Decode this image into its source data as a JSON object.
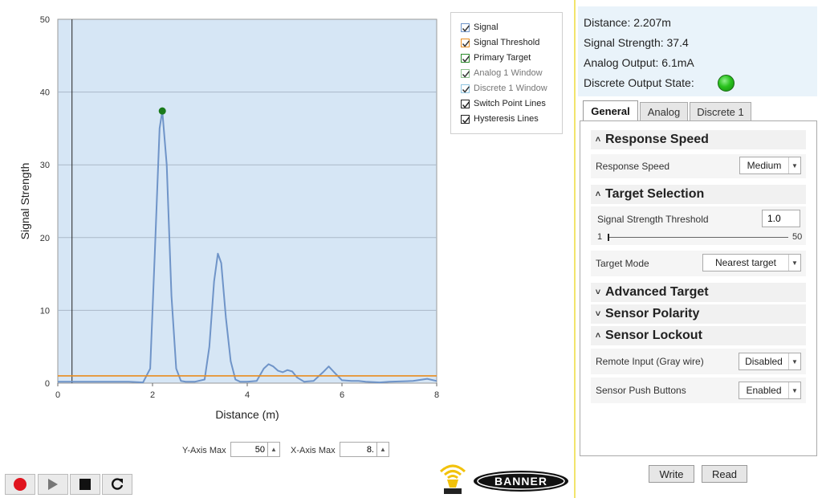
{
  "chart_data": {
    "type": "line",
    "xlabel": "Distance (m)",
    "ylabel": "Signal Strength",
    "xlim": [
      0,
      8
    ],
    "ylim": [
      0,
      50
    ],
    "x_ticks": [
      "0",
      "2",
      "4",
      "6",
      "8"
    ],
    "y_ticks": [
      "0",
      "10",
      "20",
      "30",
      "40",
      "50"
    ],
    "grid": true,
    "legend_placement": "top-right",
    "series": [
      {
        "name": "Signal",
        "color": "#6f94c8",
        "x": [
          0,
          0.5,
          1.0,
          1.5,
          1.8,
          1.95,
          2.05,
          2.15,
          2.207,
          2.3,
          2.4,
          2.5,
          2.6,
          2.7,
          2.9,
          3.1,
          3.2,
          3.3,
          3.38,
          3.45,
          3.55,
          3.65,
          3.75,
          3.85,
          4.0,
          4.2,
          4.35,
          4.45,
          4.55,
          4.65,
          4.75,
          4.85,
          4.95,
          5.05,
          5.2,
          5.4,
          5.6,
          5.72,
          5.85,
          6.0,
          6.2,
          6.35,
          6.5,
          6.8,
          7.0,
          7.5,
          7.8,
          8.0
        ],
        "y": [
          0.2,
          0.2,
          0.2,
          0.2,
          0.1,
          2.0,
          18.0,
          35.0,
          37.4,
          30.0,
          12.0,
          2.0,
          0.3,
          0.2,
          0.2,
          0.5,
          5.0,
          14.0,
          17.8,
          16.5,
          9.0,
          3.0,
          0.5,
          0.2,
          0.2,
          0.3,
          2.0,
          2.6,
          2.3,
          1.7,
          1.5,
          1.8,
          1.6,
          0.8,
          0.2,
          0.3,
          1.5,
          2.3,
          1.4,
          0.4,
          0.3,
          0.3,
          0.2,
          0.1,
          0.2,
          0.3,
          0.6,
          0.3
        ]
      },
      {
        "name": "Signal Threshold",
        "color": "#e88c1e",
        "x": [
          0,
          8
        ],
        "y": [
          1.0,
          1.0
        ]
      }
    ],
    "primary_target": {
      "x": 2.207,
      "y": 37.4,
      "color": "#1a7a1a"
    },
    "switch_point_line": {
      "x": 0.3,
      "color": "#222222"
    }
  },
  "legend": {
    "items": [
      {
        "label": "Signal",
        "checked": true,
        "color": "#6f94c8",
        "dim": false
      },
      {
        "label": "Signal Threshold",
        "checked": true,
        "color": "#e88c1e",
        "dim": false
      },
      {
        "label": "Primary Target",
        "checked": true,
        "color": "#2a8a2a",
        "dim": false
      },
      {
        "label": "Analog 1 Window",
        "checked": true,
        "color": "#8cc08c",
        "dim": true
      },
      {
        "label": "Discrete 1 Window",
        "checked": true,
        "color": "#8ec4e0",
        "dim": true
      },
      {
        "label": "Switch Point Lines",
        "checked": true,
        "color": "#222222",
        "dim": false
      },
      {
        "label": "Hysteresis Lines",
        "checked": true,
        "color": "#222222",
        "dim": false
      }
    ]
  },
  "axis_controls": {
    "y_label": "Y-Axis Max",
    "y_value": "50",
    "x_label": "X-Axis Max",
    "x_value": "8."
  },
  "brand": {
    "name": "BANNER"
  },
  "status": {
    "distance": "Distance: 2.207m",
    "signal_strength": "Signal Strength:  37.4",
    "analog_output": "Analog Output:  6.1mA",
    "discrete_state": "Discrete Output State:"
  },
  "tabs": [
    "General",
    "Analog",
    "Discrete 1"
  ],
  "sections": {
    "response_speed": {
      "title": "Response Speed",
      "label": "Response Speed",
      "value": "Medium"
    },
    "target_selection": {
      "title": "Target Selection",
      "threshold_label": "Signal Strength Threshold",
      "threshold_value": "1.0",
      "slider_min": "1",
      "slider_max": "50",
      "slider_fraction": 0.0,
      "mode_label": "Target Mode",
      "mode_value": "Nearest target"
    },
    "advanced_target": {
      "title": "Advanced Target"
    },
    "sensor_polarity": {
      "title": "Sensor Polarity"
    },
    "sensor_lockout": {
      "title": "Sensor Lockout",
      "remote_label": "Remote Input (Gray wire)",
      "remote_value": "Disabled",
      "push_label": "Sensor Push Buttons",
      "push_value": "Enabled"
    }
  },
  "buttons": {
    "write": "Write",
    "read": "Read"
  },
  "icons": {
    "expanded": "chevron-up",
    "collapsed": "chevron-down"
  }
}
